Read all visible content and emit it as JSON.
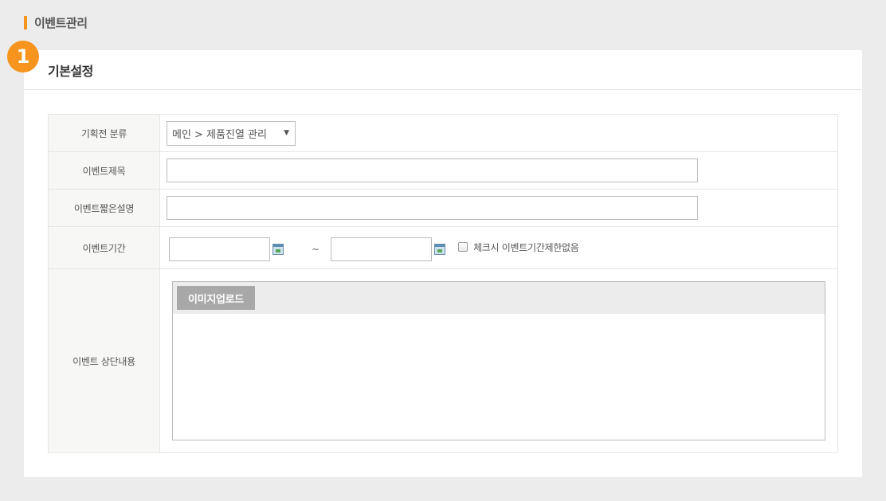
{
  "page_header": {
    "title": "이벤트관리"
  },
  "badge": {
    "number": "1"
  },
  "section": {
    "title": "기본설정"
  },
  "form": {
    "category": {
      "label": "기획전 분류",
      "selected": "메인 > 제품진열 관리"
    },
    "event_title": {
      "label": "이벤트제목",
      "value": ""
    },
    "short_desc": {
      "label": "이벤트짧은설명",
      "value": ""
    },
    "period": {
      "label": "이벤트기간",
      "start": "",
      "end": "",
      "separator": "~",
      "unlimited_label": "체크시 이벤트기간제한없음",
      "unlimited_checked": false
    },
    "top_content": {
      "label": "이벤트 상단내용",
      "upload_label": "이미지업로드"
    }
  },
  "colors": {
    "accent": "#f7941d",
    "label_bg": "#f7f7f5",
    "upload_btn": "#a8a8a8"
  },
  "icons": [
    "calendar-icon",
    "chevron-down-icon"
  ]
}
